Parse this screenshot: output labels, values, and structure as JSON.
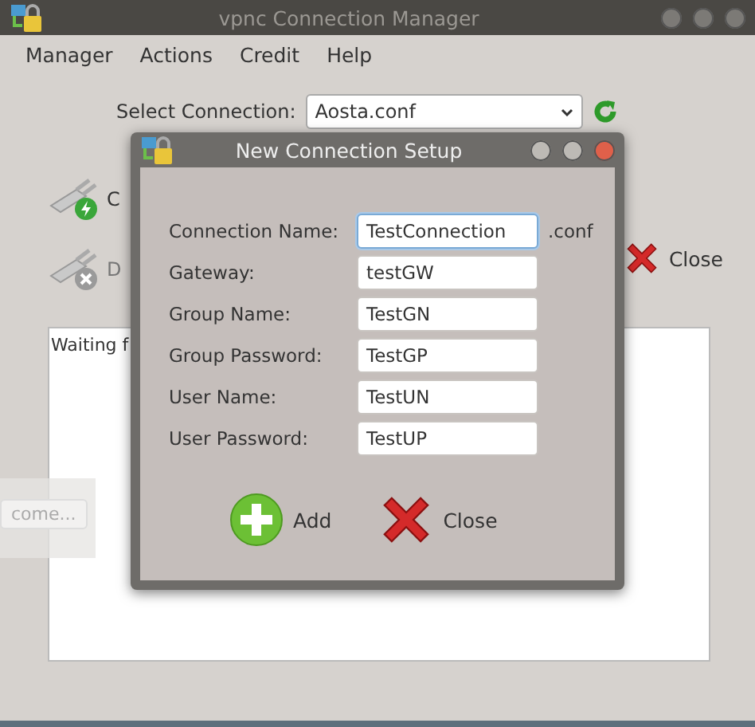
{
  "main_window": {
    "title": "vpnc Connection Manager",
    "menu": [
      "Manager",
      "Actions",
      "Credit",
      "Help"
    ],
    "select_label": "Select Connection:",
    "connection": "Aosta.conf",
    "actions": [
      {
        "kind": "connect",
        "label": "C"
      },
      {
        "kind": "disconnect",
        "label": "D"
      }
    ],
    "close_button": "Close",
    "log": "Waiting f"
  },
  "ghost_button": "come...",
  "dialog": {
    "title": "New Connection Setup",
    "fields": [
      {
        "label": "Connection Name:",
        "value": "TestConnection",
        "suffix": ".conf",
        "focused": true
      },
      {
        "label": "Gateway:",
        "value": "testGW",
        "focused": false
      },
      {
        "label": "Group Name:",
        "value": "TestGN",
        "focused": false
      },
      {
        "label": "Group Password:",
        "value": "TestGP",
        "focused": false
      },
      {
        "label": "User Name:",
        "value": "TestUN",
        "focused": false
      },
      {
        "label": "User Password:",
        "value": "TestUP",
        "focused": false
      }
    ],
    "buttons": [
      {
        "kind": "add",
        "label": "Add"
      },
      {
        "kind": "close",
        "label": "Close"
      }
    ]
  }
}
